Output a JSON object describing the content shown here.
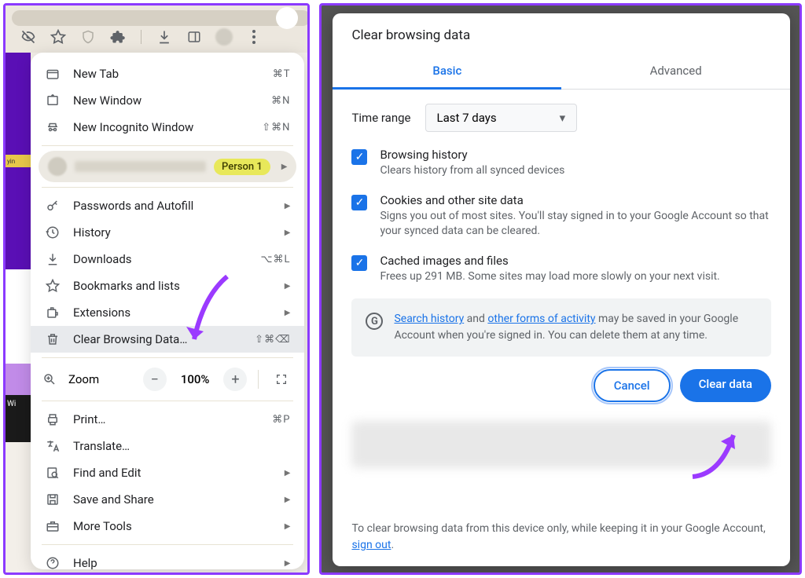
{
  "menu": {
    "new_tab": "New Tab",
    "new_tab_sc": "⌘T",
    "new_window": "New Window",
    "new_window_sc": "⌘N",
    "new_incognito": "New Incognito Window",
    "new_incognito_sc": "⇧⌘N",
    "profile_badge": "Person 1",
    "passwords": "Passwords and Autofill",
    "history": "History",
    "downloads": "Downloads",
    "downloads_sc": "⌥⌘L",
    "bookmarks": "Bookmarks and lists",
    "extensions": "Extensions",
    "clear_browsing": "Clear Browsing Data…",
    "clear_browsing_sc": "⇧⌘⌫",
    "zoom_label": "Zoom",
    "zoom_value": "100%",
    "print": "Print…",
    "print_sc": "⌘P",
    "translate": "Translate…",
    "find": "Find and Edit",
    "save_share": "Save and Share",
    "more_tools": "More Tools",
    "help": "Help"
  },
  "left_strip": {
    "yin": "yin",
    "wi": "Wi"
  },
  "dialog": {
    "title": "Clear browsing data",
    "tab_basic": "Basic",
    "tab_advanced": "Advanced",
    "time_range_label": "Time range",
    "time_range_value": "Last 7 days",
    "browsing_history_title": "Browsing history",
    "browsing_history_desc": "Clears history from all synced devices",
    "cookies_title": "Cookies and other site data",
    "cookies_desc": "Signs you out of most sites. You'll stay signed in to your Google Account so that your synced data can be cleared.",
    "cached_title": "Cached images and files",
    "cached_desc": "Frees up 291 MB. Some sites may load more slowly on your next visit.",
    "info_search_history": "Search history",
    "info_and": " and ",
    "info_other_forms": "other forms of activity",
    "info_tail": " may be saved in your Google Account when you're signed in. You can delete them at any time.",
    "cancel": "Cancel",
    "clear_data": "Clear data",
    "footer_pre": "To clear browsing data from this device only, while keeping it in your Google Account, ",
    "footer_link": "sign out",
    "footer_post": "."
  }
}
